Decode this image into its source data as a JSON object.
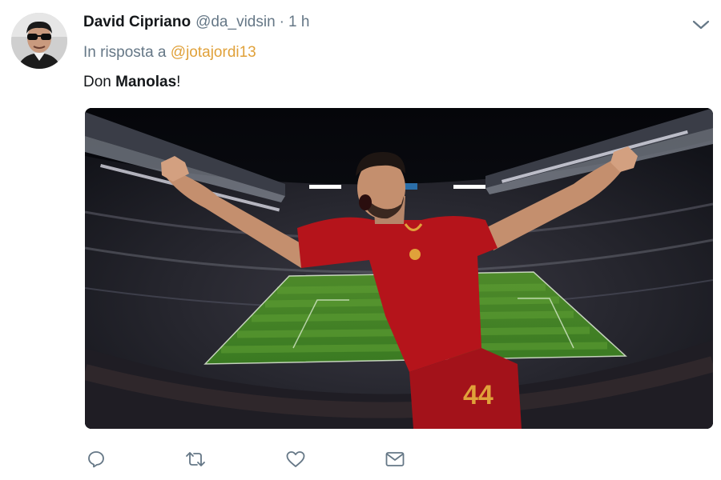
{
  "tweet": {
    "display_name": "David Cipriano",
    "handle": "@da_vidsin",
    "separator": "·",
    "time": "1 h",
    "reply_prefix": "In risposta a",
    "reply_to": "@jotajordi13",
    "text_prefix": "Don ",
    "text_bold": "Manolas",
    "text_suffix": "!"
  },
  "media": {
    "jersey_number": "44"
  },
  "icons": {
    "caret": "chevron-down-icon",
    "reply": "reply-icon",
    "retweet": "retweet-icon",
    "like": "heart-icon",
    "message": "envelope-icon"
  },
  "colors": {
    "name": "#14171a",
    "secondary": "#657786",
    "mention": "#e0a13a",
    "action_icon": "#657786",
    "jersey_red": "#b5141b"
  }
}
